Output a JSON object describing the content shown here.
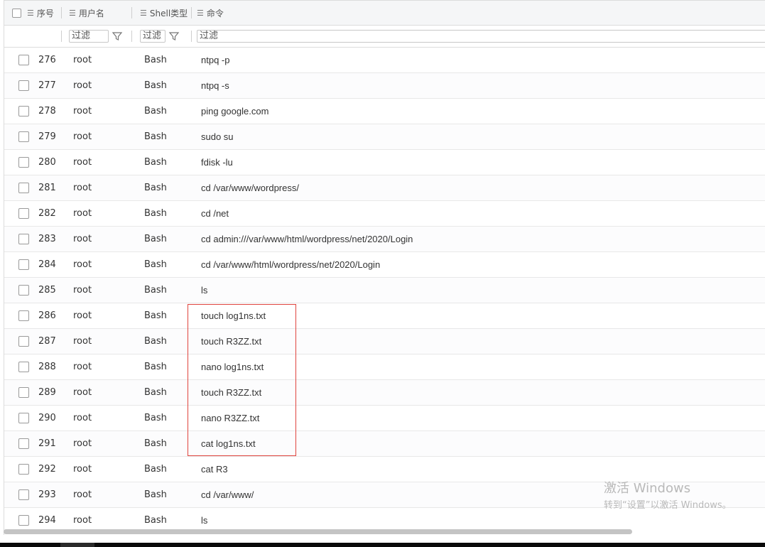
{
  "columns": {
    "index": "序号",
    "username": "用户名",
    "shell": "Shell类型",
    "command": "命令"
  },
  "filters": {
    "username": "过滤",
    "shell": "过滤",
    "command": "过滤"
  },
  "rows": [
    {
      "index": "276",
      "user": "root",
      "shell": "Bash",
      "cmd": "ntpq -p"
    },
    {
      "index": "277",
      "user": "root",
      "shell": "Bash",
      "cmd": "ntpq -s"
    },
    {
      "index": "278",
      "user": "root",
      "shell": "Bash",
      "cmd": "ping google.com"
    },
    {
      "index": "279",
      "user": "root",
      "shell": "Bash",
      "cmd": "sudo su"
    },
    {
      "index": "280",
      "user": "root",
      "shell": "Bash",
      "cmd": "fdisk -lu"
    },
    {
      "index": "281",
      "user": "root",
      "shell": "Bash",
      "cmd": "cd /var/www/wordpress/"
    },
    {
      "index": "282",
      "user": "root",
      "shell": "Bash",
      "cmd": "cd /net"
    },
    {
      "index": "283",
      "user": "root",
      "shell": "Bash",
      "cmd": "cd admin:///var/www/html/wordpress/net/2020/Login"
    },
    {
      "index": "284",
      "user": "root",
      "shell": "Bash",
      "cmd": "cd /var/www/html/wordpress/net/2020/Login"
    },
    {
      "index": "285",
      "user": "root",
      "shell": "Bash",
      "cmd": "ls"
    },
    {
      "index": "286",
      "user": "root",
      "shell": "Bash",
      "cmd": "touch log1ns.txt"
    },
    {
      "index": "287",
      "user": "root",
      "shell": "Bash",
      "cmd": "touch R3ZZ.txt"
    },
    {
      "index": "288",
      "user": "root",
      "shell": "Bash",
      "cmd": "nano log1ns.txt"
    },
    {
      "index": "289",
      "user": "root",
      "shell": "Bash",
      "cmd": "touch R3ZZ.txt"
    },
    {
      "index": "290",
      "user": "root",
      "shell": "Bash",
      "cmd": "nano R3ZZ.txt"
    },
    {
      "index": "291",
      "user": "root",
      "shell": "Bash",
      "cmd": "cat log1ns.txt"
    },
    {
      "index": "292",
      "user": "root",
      "shell": "Bash",
      "cmd": "cat R3"
    },
    {
      "index": "293",
      "user": "root",
      "shell": "Bash",
      "cmd": "cd /var/www/"
    },
    {
      "index": "294",
      "user": "root",
      "shell": "Bash",
      "cmd": "ls"
    }
  ],
  "watermark": {
    "title": "激活 Windows",
    "subtitle": "转到“设置”以激活 Windows。"
  },
  "colors": {
    "highlight_border": "#e0443e",
    "header_bg": "#f5f6f7"
  }
}
